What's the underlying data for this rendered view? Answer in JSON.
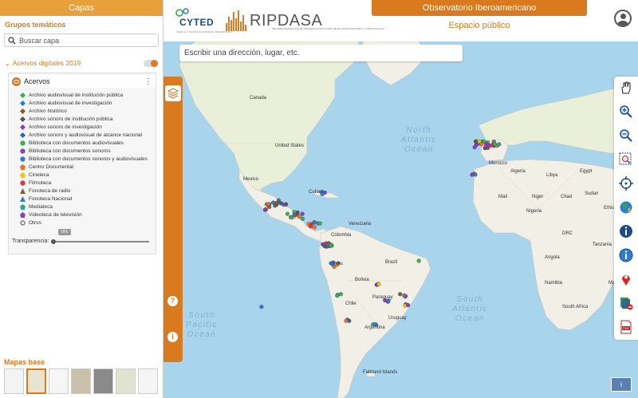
{
  "sidebar": {
    "title": "Capas",
    "groups_title": "Grupos temáticos",
    "search_placeholder": "Buscar capa",
    "group_name": "Acervos digitales 2019",
    "layer_name": "Acervos",
    "legend": [
      {
        "label": "Archivo audiovisual de institución pública",
        "shape": "diamond",
        "color": "#2fb84a"
      },
      {
        "label": "Archivo audiovisual de investigación",
        "shape": "diamond",
        "color": "#2a7fd4"
      },
      {
        "label": "Archivo histórico",
        "shape": "diamond",
        "color": "#8b5a2b"
      },
      {
        "label": "Archivo sonoro de institución pública",
        "shape": "diamond",
        "color": "#555555"
      },
      {
        "label": "Archivo sonoro de investigación",
        "shape": "diamond",
        "color": "#8a3fc0"
      },
      {
        "label": "Archivo sonoro y audiovisual de alcance nacional",
        "shape": "diamond",
        "color": "#1e6bb8"
      },
      {
        "label": "Biblioteca con documentos audiovisuales",
        "shape": "circle",
        "color": "#2fb84a"
      },
      {
        "label": "Biblioteca con documentos sonoros",
        "shape": "circle",
        "color": "#8a3fc0"
      },
      {
        "label": "Biblioteca con documentos sonoros y audiovisuales",
        "shape": "circle",
        "color": "#2a7fd4"
      },
      {
        "label": "Centro Documental",
        "shape": "pentagon",
        "color": "#f07020"
      },
      {
        "label": "Cineteca",
        "shape": "pentagon",
        "color": "#f0c020"
      },
      {
        "label": "Filmoteca",
        "shape": "circle",
        "color": "#e0304a"
      },
      {
        "label": "Fonoteca de radio",
        "shape": "triangle",
        "color": "#8b5a2b"
      },
      {
        "label": "Fonoteca Nacional",
        "shape": "triangle",
        "color": "#2a7fd4"
      },
      {
        "label": "Mediateca",
        "shape": "pentagon",
        "color": "#2fa88a"
      },
      {
        "label": "Videoteca de televisión",
        "shape": "pentagon",
        "color": "#8a3fc0"
      },
      {
        "label": "Otros",
        "shape": "ring",
        "color": "#777777"
      }
    ],
    "opacity_value": "0%",
    "opacity_label": "Transparencia:",
    "basemaps_title": "Mapas base"
  },
  "header": {
    "logo1": "CYTED",
    "logo1_sub": "CIENCIA Y TECNOLOGÍA PARA EL DESARROLLO",
    "logo2": "RIPDASA",
    "logo2_sub": "RED IBEROAMERICANA DE PRESERVACIÓN DIGITAL DE ARCHIVOS SONOROS Y AUDIOVISUALES",
    "title": "Observatorio Iberoamericano",
    "subtitle": "Espacio público"
  },
  "map": {
    "search_placeholder": "Escribir una dirección, lugar, etc.",
    "labels": {
      "north_atlantic": "North\nAtlantic\nOcean",
      "south_atlantic": "South\nAtlantic\nOcean",
      "south_pacific": "South\nPacific\nOcean",
      "canada": "Canada",
      "us": "United States",
      "mexico": "Mexico",
      "cuba": "Cuba",
      "venezuela": "Venezuela",
      "colombia": "Colombia",
      "peru": "Peru",
      "brazil": "Brazil",
      "bolivia": "Bolivia",
      "chile": "Chile",
      "argentina": "Argentina",
      "uruguay": "Uruguay",
      "paraguay": "Paraguay",
      "falklands": "Falkland Islands",
      "algeria": "Algeria",
      "libya": "Libya",
      "egypt": "Egypt",
      "niger": "Niger",
      "mali": "Mali",
      "chad": "Chad",
      "nigeria": "Nigeria",
      "ethiopia": "Ethiopia",
      "drc": "DRC",
      "angola": "Angola",
      "namibia": "Namibia",
      "south_africa": "South Africa",
      "madagascar": "Madagascar",
      "tanzania": "Tanzania",
      "sudan": "Sudan",
      "morocco": "Morocco"
    },
    "help_icon": "?",
    "info_icon": "i",
    "footer_button": "i"
  },
  "toolbar_icons": [
    "pan-icon",
    "zoom-in-icon",
    "zoom-out-icon",
    "zoom-box-icon",
    "locate-icon",
    "globe-icon",
    "info-icon",
    "info-circle-icon",
    "pin-icon",
    "print-icon",
    "pdf-icon"
  ],
  "colors": {
    "accent": "#d97a1f",
    "water": "#a8d4ec",
    "land": "#f2efe6"
  }
}
